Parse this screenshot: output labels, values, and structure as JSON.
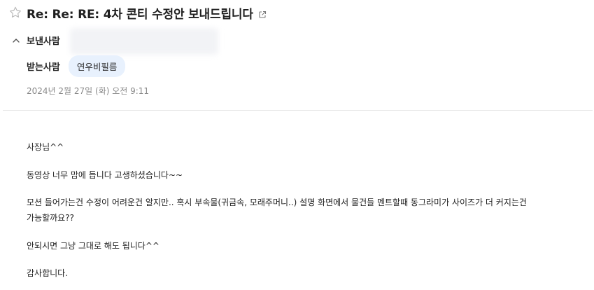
{
  "subject": "Re: Re: RE: 4차 콘티 수정안 보내드립니다",
  "header": {
    "from_label": "보낸사람",
    "to_label": "받는사람",
    "recipient": "연우비필름",
    "date": "2024년 2월 27일 (화) 오전 9:11"
  },
  "body": {
    "line1": "사장님^^",
    "line2": "동영상 너무 맘에 듭니다 고생하셨습니다~~",
    "line3a": "모션 들어가는건 수정이 어려운건 알지만.. 혹시 부속물(귀금속, 모래주머니..) 설명 화면에서 물건들 멘트할때 동그라미가 사이즈가 더 커지는건",
    "line3b": "가능할까요??",
    "line4": "안되시면 그냥 그대로 해도 됩니다^^",
    "line5": "감사합니다."
  },
  "icons": {
    "star": "star-outline-icon",
    "popout": "external-link-icon",
    "collapse": "chevron-up-icon"
  },
  "colors": {
    "chip_bg": "#e8f1fd",
    "date_text": "#8a8a8a",
    "divider": "#e6e6e6"
  }
}
